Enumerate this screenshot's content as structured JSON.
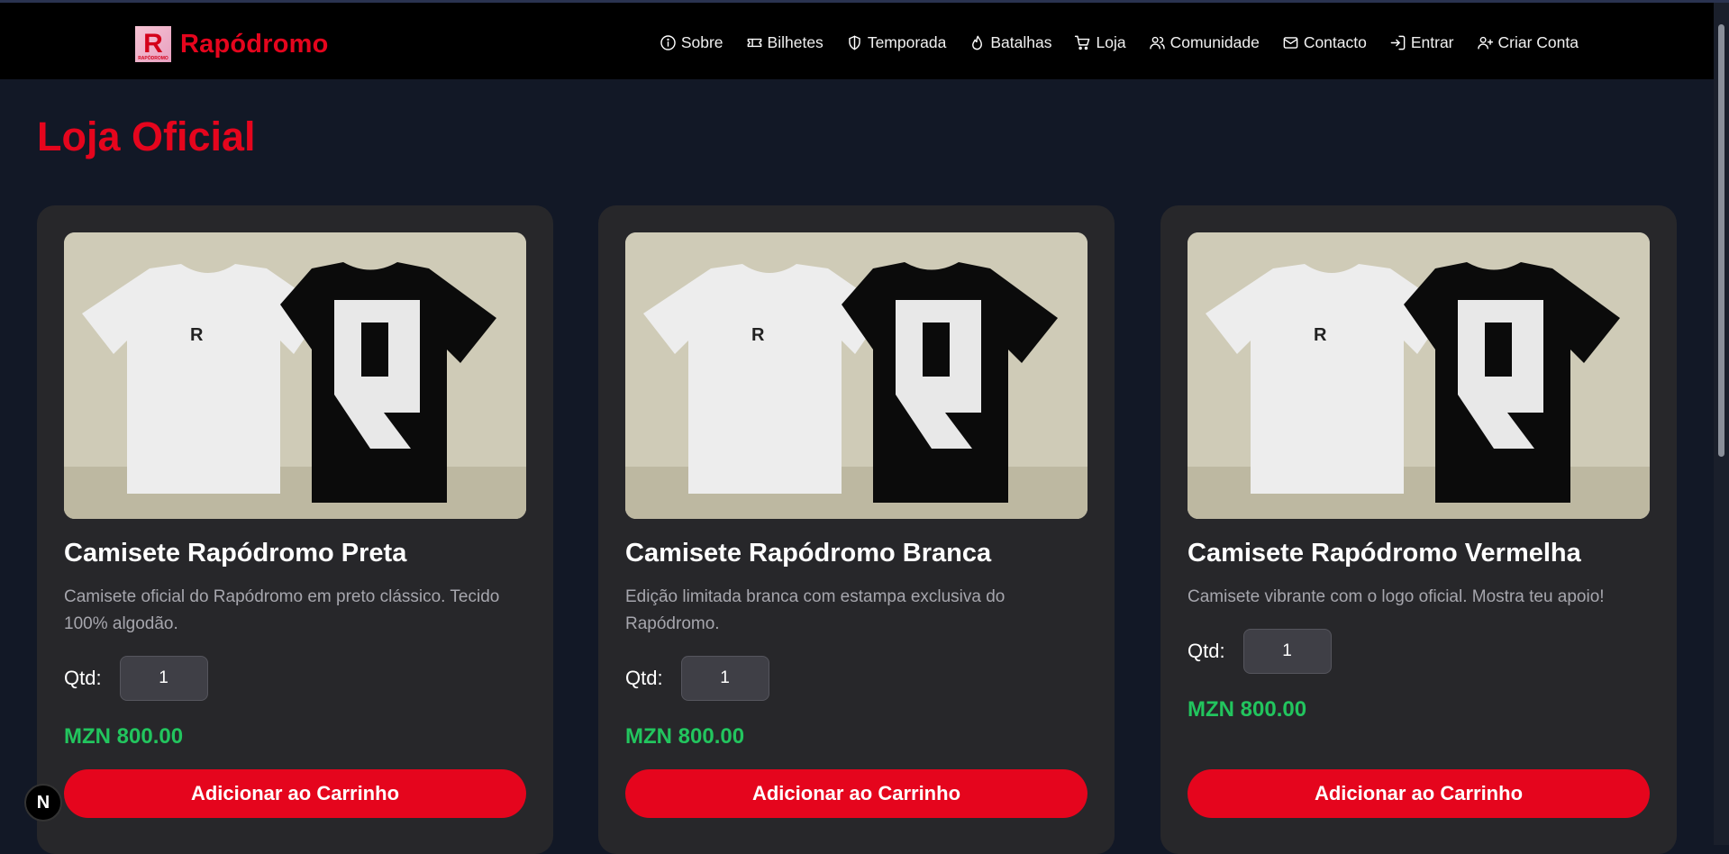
{
  "brand": {
    "name": "Rapódromo",
    "logo_letter": "R",
    "logo_caption": "RAPÓDROMO"
  },
  "nav": [
    {
      "label": "Sobre",
      "icon": "info-icon"
    },
    {
      "label": "Bilhetes",
      "icon": "ticket-icon"
    },
    {
      "label": "Temporada",
      "icon": "shield-icon"
    },
    {
      "label": "Batalhas",
      "icon": "flame-icon"
    },
    {
      "label": "Loja",
      "icon": "cart-icon"
    },
    {
      "label": "Comunidade",
      "icon": "users-icon"
    },
    {
      "label": "Contacto",
      "icon": "mail-icon"
    },
    {
      "label": "Entrar",
      "icon": "login-icon"
    },
    {
      "label": "Criar Conta",
      "icon": "user-plus-icon"
    }
  ],
  "page": {
    "title": "Loja Oficial"
  },
  "products": [
    {
      "name": "Camisete Rapódromo Preta",
      "description": "Camisete oficial do Rapódromo em preto clássico. Tecido 100% algodão.",
      "qty_label": "Qtd:",
      "qty": "1",
      "price": "MZN 800.00",
      "button": "Adicionar ao Carrinho"
    },
    {
      "name": "Camisete Rapódromo Branca",
      "description": "Edição limitada branca com estampa exclusiva do Rapódromo.",
      "qty_label": "Qtd:",
      "qty": "1",
      "price": "MZN 800.00",
      "button": "Adicionar ao Carrinho"
    },
    {
      "name": "Camisete Rapódromo Vermelha",
      "description": "Camisete vibrante com o logo oficial. Mostra teu apoio!",
      "qty_label": "Qtd:",
      "qty": "1",
      "price": "MZN 800.00",
      "button": "Adicionar ao Carrinho"
    }
  ],
  "dev_badge": "N",
  "colors": {
    "accent": "#e5051d",
    "price": "#22c55e",
    "card": "#27272a",
    "background": "#121826"
  }
}
